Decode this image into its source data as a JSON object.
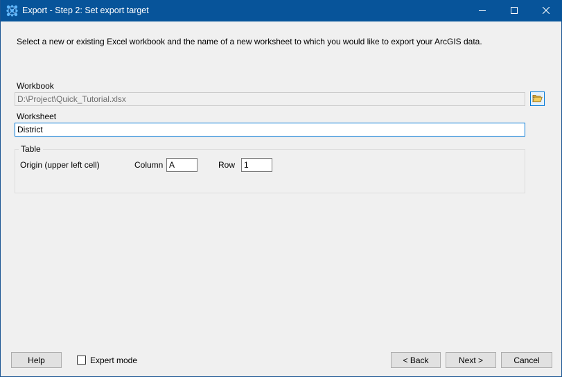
{
  "window": {
    "title": "Export - Step 2: Set export target",
    "app_icon": "network-nodes-icon",
    "controls": [
      "minimize-icon",
      "maximize-icon",
      "close-icon"
    ]
  },
  "instruction": "Select a new or existing Excel workbook and the name of a new worksheet to which you would like to export your ArcGIS data.",
  "workbook": {
    "label": "Workbook",
    "value": "D:\\Project\\Quick_Tutorial.xlsx",
    "browse_icon": "open-folder-icon"
  },
  "worksheet": {
    "label": "Worksheet",
    "value": "District"
  },
  "table": {
    "title": "Table",
    "origin_label": "Origin (upper left cell)",
    "column_label": "Column",
    "column_value": "A",
    "row_label": "Row",
    "row_value": "1"
  },
  "footer": {
    "help_label": "Help",
    "expert_mode_label": "Expert mode",
    "expert_mode_checked": false,
    "back_label": "< Back",
    "next_label": "Next >",
    "cancel_label": "Cancel"
  },
  "colors": {
    "titlebar": "#07549a",
    "focus_border": "#0078d7",
    "background": "#f0f0f0"
  }
}
